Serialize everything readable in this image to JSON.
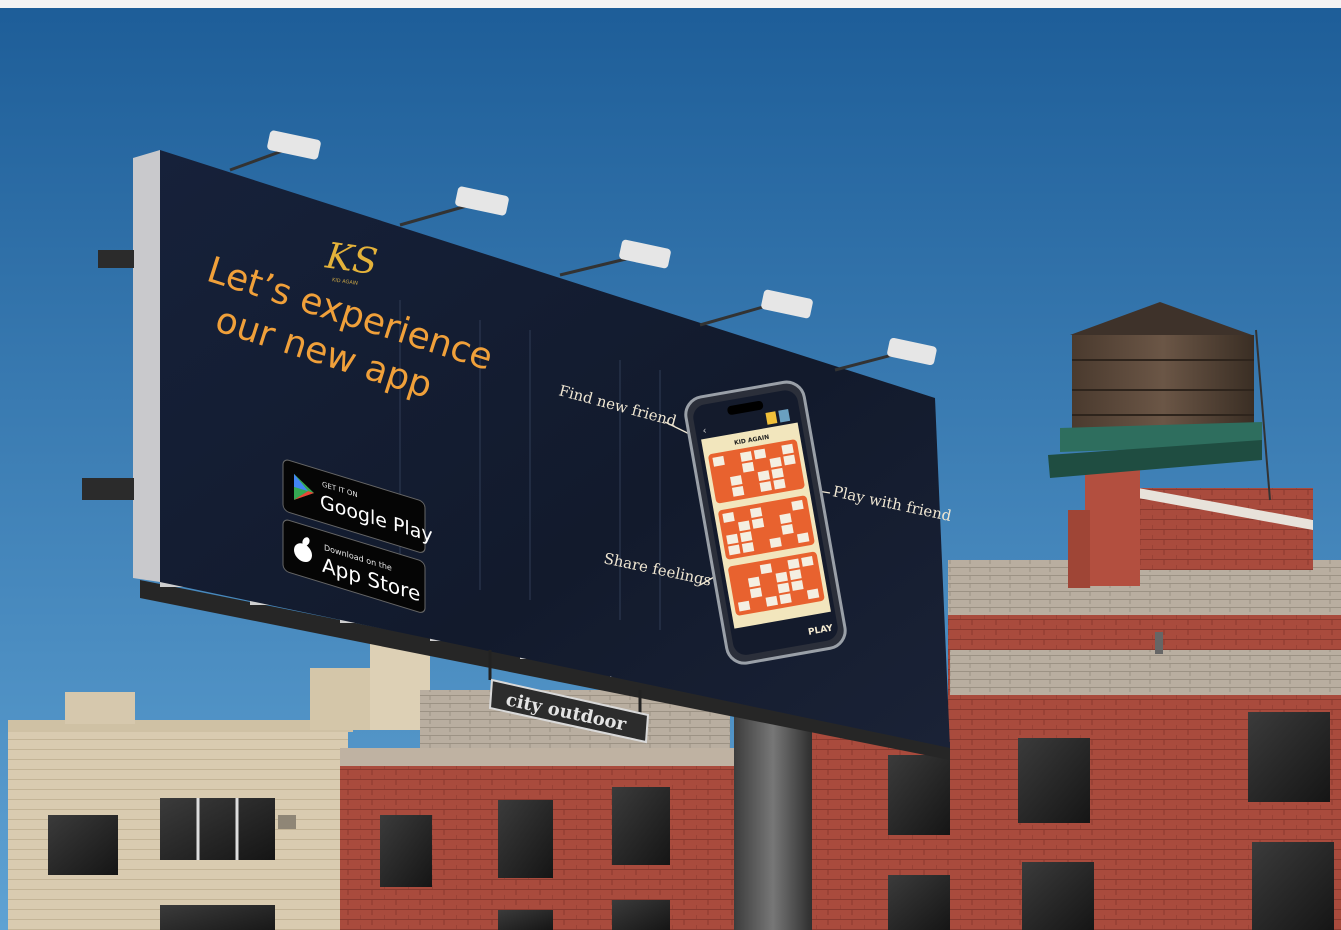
{
  "colors": {
    "sky_top": "#1e5f9a",
    "sky_bottom": "#5d9fd1",
    "billboard": "#131a2c",
    "headline": "#f0a03a",
    "brick": "#a84a3c",
    "tan_building": "#d8c9ad",
    "callout_text": "#efe6d2",
    "game_orange": "#e8622f",
    "game_cream": "#f2e6bd"
  },
  "billboard": {
    "logo_monogram": "KS",
    "logo_name": "KID AGAIN",
    "headline_line1": "Let’s experience",
    "headline_line2": "our new app",
    "google_play": {
      "small": "GET IT ON",
      "big": "Google Play"
    },
    "app_store": {
      "small": "Download on the",
      "big": "App Store"
    },
    "callouts": {
      "find_new_friend": "Find new friend",
      "play_with_friend": "Play with friend",
      "share_feelings": "Share feelings"
    },
    "phone": {
      "app_title": "KID AGAIN",
      "play_button": "PLAY"
    }
  },
  "sign": {
    "text": "city outdoor"
  }
}
